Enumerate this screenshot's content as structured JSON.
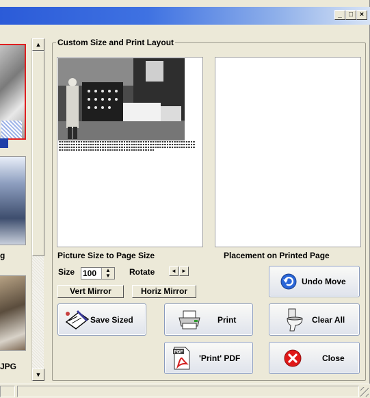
{
  "window": {
    "controls": {
      "minimize": "_",
      "maximize": "□",
      "close": "×"
    }
  },
  "thumbnails": [
    {
      "label": ""
    },
    {
      "label": "g"
    },
    {
      "label": "JPG"
    }
  ],
  "scrollbar": {
    "up": "▲",
    "down": "▼"
  },
  "group": {
    "title": "Custom Size and Print Layout"
  },
  "left_panel": {
    "caption": "Picture Size to Page Size"
  },
  "right_panel": {
    "caption": "Placement on Printed Page"
  },
  "size_control": {
    "label": "Size",
    "value": "100"
  },
  "rotate_control": {
    "label": "Rotate",
    "left": "◄",
    "right": "►"
  },
  "buttons": {
    "vert_mirror": "Vert Mirror",
    "horiz_mirror": "Horiz Mirror",
    "undo_move": "Undo Move",
    "save_sized": "Save Sized",
    "print": "Print",
    "clear_all": "Clear All",
    "print_pdf": "'Print' PDF",
    "close": "Close"
  },
  "icons": {
    "undo": "undo-icon",
    "save": "save-sized-icon",
    "print": "printer-icon",
    "clear": "toilet-icon",
    "pdf": "pdf-icon",
    "close": "close-icon"
  },
  "colors": {
    "titlebar": "#2b5bd8",
    "undo_icon": "#2a66d8",
    "close_icon": "#e01818",
    "pdf_red": "#d32020"
  }
}
